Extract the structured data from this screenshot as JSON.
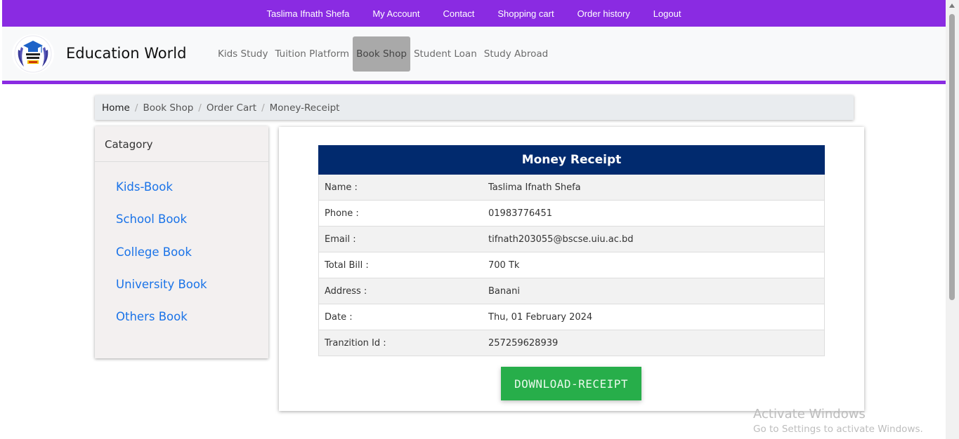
{
  "topbar": {
    "items": [
      "Taslima Ifnath Shefa",
      "My Account",
      "Contact",
      "Shopping cart",
      "Order history",
      "Logout"
    ]
  },
  "header": {
    "brand": "Education World",
    "logo_icon": "graduation-cap-icon",
    "nav": [
      "Kids Study",
      "Tuition Platform",
      "Book Shop",
      "Student Loan",
      "Study Abroad"
    ],
    "active_nav": "Book Shop"
  },
  "breadcrumb": [
    "Home",
    "Book Shop",
    "Order Cart",
    "Money-Receipt"
  ],
  "category": {
    "title": "Catagory",
    "items": [
      "Kids-Book",
      "School Book",
      "College Book",
      "University Book",
      "Others Book"
    ]
  },
  "receipt": {
    "title": "Money Receipt",
    "rows": [
      {
        "label": "Name :",
        "value": "Taslima Ifnath Shefa"
      },
      {
        "label": "Phone :",
        "value": "01983776451"
      },
      {
        "label": "Email :",
        "value": "tifnath203055@bscse.uiu.ac.bd"
      },
      {
        "label": "Total Bill :",
        "value": "700 Tk"
      },
      {
        "label": "Address :",
        "value": "Banani"
      },
      {
        "label": "Date :",
        "value": "Thu, 01 February 2024"
      },
      {
        "label": "Tranzition Id :",
        "value": "257259628939"
      }
    ],
    "download_label": "DOWNLOAD-RECEIPT"
  },
  "watermark": {
    "line1": "Activate Windows",
    "line2": "Go to Settings to activate Windows."
  },
  "colors": {
    "topbar": "#8a2be2",
    "receipt_header": "#012a6e",
    "download_button": "#27ae4a",
    "link": "#1a73e8"
  }
}
